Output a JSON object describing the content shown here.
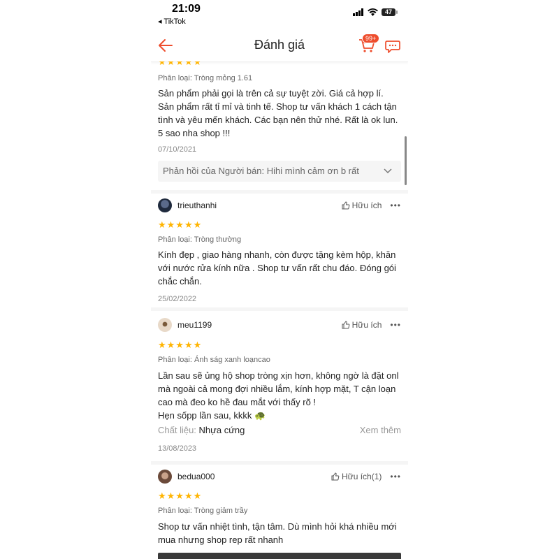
{
  "status_bar": {
    "time": "21:09",
    "back_app": "◂ TikTok",
    "battery": "47"
  },
  "navbar": {
    "title": "Đánh giá",
    "cart_badge": "99+"
  },
  "review0": {
    "variant": "Phân loại: Tròng mỏng 1.61",
    "text": "Sản phẩm phải gọi là trên cả sự tuyệt zời. Giá cả hợp lí. Sản phẩm rất tỉ mỉ và tinh tế. Shop tư vấn khách 1 cách tận tình và yêu mến khách. Các bạn nên thử nhé. Rất là ok lun. 5 sao nha shop !!!",
    "date": "07/10/2021",
    "seller_reply_label": "Phản hồi của Người bán:",
    "seller_reply_text": "Hihi mình cảm ơn b rất"
  },
  "reviews": [
    {
      "username": "trieuthanhi",
      "helpful": "Hữu ích",
      "more": "•••",
      "stars": "★★★★★",
      "variant": "Phân loại: Tròng thường",
      "text": "Kính đẹp , giao hàng nhanh, còn được tặng kèm hộp, khăn với nước rửa kính nữa . Shop tư vấn rất chu đáo. Đóng gói chắc chắn.",
      "date": "25/02/2022"
    },
    {
      "username": "meu1199",
      "helpful": "Hữu ích",
      "more": "•••",
      "stars": "★★★★★",
      "variant": "Phân loại: Ánh ság xanh loạncao",
      "text": "Lần sau sẽ ủng hộ shop tròng xịn hơn, không ngờ là đặt onl mà ngoài cả mong đợi nhiều lắm, kính hợp mặt, T cận loạn cao mà đeo ko hề đau mắt với thấy rõ !",
      "text2": "Hẹn sốpp lần sau, kkkk 🐢",
      "material_label": "Chất liệu:",
      "material_value": "Nhựa cứng",
      "see_more": "Xem thêm",
      "date": "13/08/2023"
    },
    {
      "username": "bedua000",
      "helpful": "Hữu ích(1)",
      "more": "•••",
      "stars": "★★★★★",
      "variant": "Phân loại: Tròng giảm trầy",
      "text": "Shop tư vấn nhiệt tình, tận tâm. Dù mình hỏi khá nhiều mới mua nhưng shop rep rất nhanh"
    }
  ],
  "colors": {
    "accent": "#ee4d2d",
    "star": "#ffb400"
  }
}
